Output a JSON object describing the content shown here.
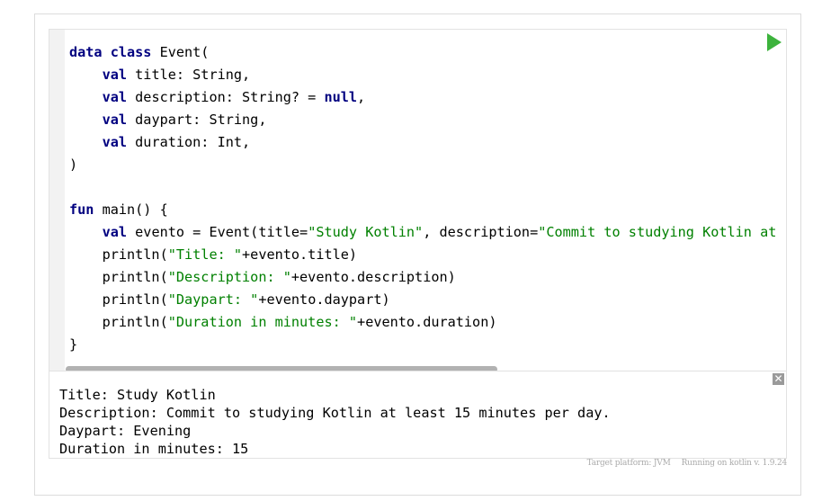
{
  "code_lines": [
    [
      {
        "t": "data class",
        "c": "kw"
      },
      {
        "t": " Event("
      }
    ],
    [
      {
        "t": "    "
      },
      {
        "t": "val",
        "c": "kw"
      },
      {
        "t": " title: String,"
      }
    ],
    [
      {
        "t": "    "
      },
      {
        "t": "val",
        "c": "kw"
      },
      {
        "t": " description: String? = "
      },
      {
        "t": "null",
        "c": "kw"
      },
      {
        "t": ","
      }
    ],
    [
      {
        "t": "    "
      },
      {
        "t": "val",
        "c": "kw"
      },
      {
        "t": " daypart: String,"
      }
    ],
    [
      {
        "t": "    "
      },
      {
        "t": "val",
        "c": "kw"
      },
      {
        "t": " duration: Int,"
      }
    ],
    [
      {
        "t": ")"
      }
    ],
    [
      {
        "t": ""
      }
    ],
    [
      {
        "t": "fun",
        "c": "kw"
      },
      {
        "t": " main() {"
      }
    ],
    [
      {
        "t": "    "
      },
      {
        "t": "val",
        "c": "kw"
      },
      {
        "t": " evento = Event(title="
      },
      {
        "t": "\"Study Kotlin\"",
        "c": "str"
      },
      {
        "t": ", description="
      },
      {
        "t": "\"Commit to studying Kotlin at",
        "c": "str"
      }
    ],
    [
      {
        "t": "    println("
      },
      {
        "t": "\"Title: \"",
        "c": "str"
      },
      {
        "t": "+evento.title)"
      }
    ],
    [
      {
        "t": "    println("
      },
      {
        "t": "\"Description: \"",
        "c": "str"
      },
      {
        "t": "+evento.description)"
      }
    ],
    [
      {
        "t": "    println("
      },
      {
        "t": "\"Daypart: \"",
        "c": "str"
      },
      {
        "t": "+evento.daypart)"
      }
    ],
    [
      {
        "t": "    println("
      },
      {
        "t": "\"Duration in minutes: \"",
        "c": "str"
      },
      {
        "t": "+evento.duration)"
      }
    ],
    [
      {
        "t": "}"
      }
    ]
  ],
  "output_lines": [
    "Title: Study Kotlin",
    "Description: Commit to studying Kotlin at least 15 minutes per day.",
    "Daypart: Evening",
    "Duration in minutes: 15"
  ],
  "close_label": "✕",
  "footer": {
    "platform": "Target platform: JVM",
    "version": "Running on kotlin v. 1.9.24"
  },
  "colors": {
    "keyword": "#000080",
    "string": "#008000",
    "run": "#3db33d"
  },
  "icons": {
    "run": "play-icon",
    "close": "close-icon"
  }
}
